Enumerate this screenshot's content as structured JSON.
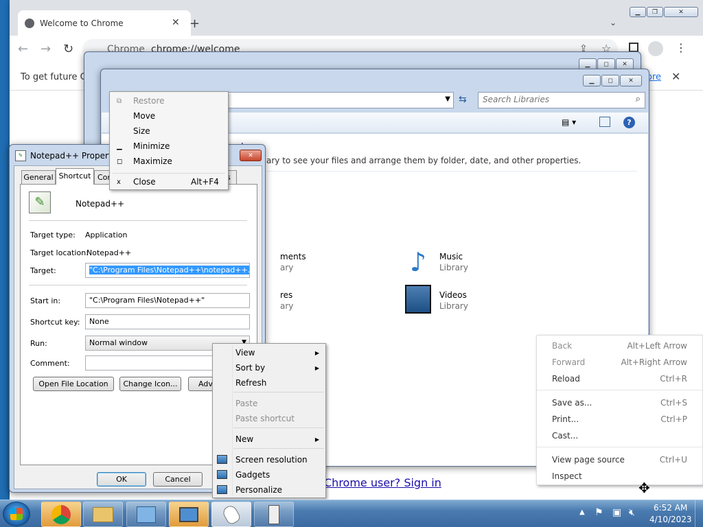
{
  "chrome": {
    "tab_title": "Welcome to Chrome",
    "address_scheme": "Chrome",
    "address_url": "chrome://welcome",
    "infobar_text": "To get future Go",
    "infobar_link_tail": "ore",
    "signin_text": "Chrome user? Sign in"
  },
  "explorer": {
    "search_placeholder": "Search Libraries",
    "heading": "Libraries",
    "subtitle": "ary to see your files and arrange them by folder, date, and other properties.",
    "items": [
      {
        "name": "ments",
        "type": "ary"
      },
      {
        "name": "res",
        "type": "ary"
      },
      {
        "name": "Music",
        "type": "Library"
      },
      {
        "name": "Videos",
        "type": "Library"
      }
    ]
  },
  "props": {
    "title": "Notepad++ Properties",
    "tabs": [
      "General",
      "Shortcut",
      "Comp",
      "s"
    ],
    "app_name": "Notepad++",
    "target_type_label": "Target type:",
    "target_type": "Application",
    "target_location_label": "Target location:",
    "target_location": "Notepad++",
    "target_label": "Target:",
    "target": "\"C:\\Program Files\\Notepad++\\notepad++.exe\"",
    "start_in_label": "Start in:",
    "start_in": "\"C:\\Program Files\\Notepad++\"",
    "shortcut_key_label": "Shortcut key:",
    "shortcut_key": "None",
    "run_label": "Run:",
    "run_value": "Normal window",
    "comment_label": "Comment:",
    "comment": "",
    "btn_open_location": "Open File Location",
    "btn_change_icon": "Change Icon...",
    "btn_advanced": "Adva",
    "btn_ok": "OK",
    "btn_cancel": "Cancel"
  },
  "system_menu": [
    {
      "label": "Restore",
      "glyph": "⧉",
      "disabled": true
    },
    {
      "label": "Move",
      "glyph": "",
      "disabled": false
    },
    {
      "label": "Size",
      "glyph": "",
      "disabled": false
    },
    {
      "label": "Minimize",
      "glyph": "▁",
      "disabled": false
    },
    {
      "label": "Maximize",
      "glyph": "◻",
      "disabled": false
    },
    {
      "label": "Close",
      "glyph": "x",
      "shortcut": "Alt+F4",
      "disabled": false
    }
  ],
  "desktop_menu": [
    {
      "label": "View",
      "submenu": true
    },
    {
      "label": "Sort by",
      "submenu": true
    },
    {
      "label": "Refresh"
    },
    {
      "label": "Paste",
      "disabled": true
    },
    {
      "label": "Paste shortcut",
      "disabled": true
    },
    {
      "label": "New",
      "submenu": true
    },
    {
      "label": "Screen resolution"
    },
    {
      "label": "Gadgets"
    },
    {
      "label": "Personalize"
    }
  ],
  "chrome_menu": [
    {
      "label": "Back",
      "shortcut": "Alt+Left Arrow",
      "disabled": true
    },
    {
      "label": "Forward",
      "shortcut": "Alt+Right Arrow",
      "disabled": true
    },
    {
      "label": "Reload",
      "shortcut": "Ctrl+R"
    },
    {
      "label": "Save as...",
      "shortcut": "Ctrl+S"
    },
    {
      "label": "Print...",
      "shortcut": "Ctrl+P"
    },
    {
      "label": "Cast...",
      "shortcut": ""
    },
    {
      "label": "View page source",
      "shortcut": "Ctrl+U"
    },
    {
      "label": "Inspect",
      "shortcut": ""
    }
  ],
  "taskbar": {
    "time": "6:52 AM",
    "date": "4/10/2023"
  },
  "colors": {
    "desktop": "#1f6db3",
    "selection": "#3399ff",
    "link": "#1a0dab"
  }
}
